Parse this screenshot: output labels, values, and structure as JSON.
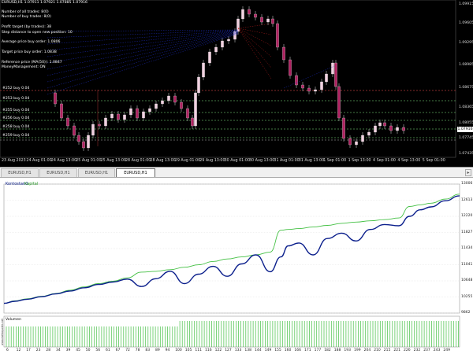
{
  "price_panel": {
    "header": "EURUSD,H1  1.07911 1.07921 1.07885 1.07916",
    "info_lines": [
      "Number of all trades: 8(0)",
      "Number of buy trades: 8(0)",
      "",
      "Profit target (by trades): 38",
      "Step distance to open new position: 10",
      "",
      "Average price buy order: 1.0806",
      "",
      "Target price buy order: 1.0838",
      "",
      "Reference price (MA(50)): 1.0847",
      "MoneyManagement: ON"
    ],
    "levels": [
      "#252 buy 0.04",
      "#253 buy 0.04",
      "#255 buy 0.04",
      "#256 buy 0.04",
      "#258 buy 0.04",
      "#259 buy 0.04"
    ],
    "price_ticks": [
      "1.09915",
      "1.09605",
      "1.09295",
      "1.08985",
      "1.08675",
      "1.08365",
      "1.08055",
      "1.07745",
      "1.07435"
    ],
    "current_price": "1.07916",
    "date_ticks": [
      "23 Aug 2023",
      "24 Aug 01:00",
      "24 Aug 13:00",
      "25 Aug 01:00",
      "25 Aug 13:00",
      "28 Aug 01:00",
      "28 Aug 13:00",
      "29 Aug 01:00",
      "29 Aug 13:00",
      "30 Aug 01:00",
      "30 Aug 13:00",
      "31 Aug 01:00",
      "31 Aug 13:00",
      "1 Sep 01:00",
      "1 Sep 13:00",
      "4 Sep 01:00",
      "4 Sep 13:00",
      "5 Sep 01:00"
    ]
  },
  "tabs": [
    "EURUSD,H1 (visual)",
    "EURUSD,H1 (visual)",
    "EURUSD,H1 (visual)",
    "EURUSD,H1 (visual)"
  ],
  "active_tab": 3,
  "tester": {
    "legend_balance": "Kontostand",
    "legend_equity": "Kapital",
    "volume_label": "Volumen",
    "side_caption": "www.metaquotes.net",
    "colors": {
      "balance": "#0b1f8c",
      "equity": "#44c044",
      "volume": "#44c044"
    },
    "y_ticks": [
      "13006",
      "12613",
      "12220",
      "11827",
      "11434",
      "11041",
      "10648",
      "10255",
      "9862"
    ],
    "x_ticks": [
      "6",
      "12",
      "17",
      "23",
      "28",
      "34",
      "39",
      "45",
      "50",
      "56",
      "61",
      "67",
      "72",
      "78",
      "83",
      "89",
      "94",
      "100",
      "105",
      "111",
      "116",
      "122",
      "127",
      "133",
      "138",
      "144",
      "149",
      "155",
      "160",
      "166",
      "171",
      "177",
      "182",
      "188",
      "193",
      "199",
      "204",
      "210",
      "215",
      "221",
      "226",
      "232",
      "237",
      "243",
      "249"
    ]
  },
  "chart_data": {
    "type": "line",
    "title": "",
    "xlabel": "",
    "ylabel": "",
    "ylim": [
      9862,
      13006
    ],
    "x": [
      1,
      7,
      14,
      22,
      30,
      38,
      46,
      54,
      62,
      70,
      78,
      86,
      94,
      102,
      110,
      118,
      126,
      134,
      142,
      150,
      156,
      160,
      166,
      174,
      182,
      190,
      198,
      206,
      214,
      222,
      228,
      234,
      240,
      248,
      256
    ],
    "series": [
      {
        "name": "Kontostand",
        "values": [
          10100,
          10150,
          10200,
          10260,
          10330,
          10400,
          10480,
          10560,
          10620,
          10690,
          10510,
          10700,
          10880,
          10580,
          10810,
          11000,
          10760,
          11060,
          11280,
          10870,
          11230,
          11500,
          11570,
          11280,
          11680,
          11810,
          11620,
          11900,
          12020,
          11990,
          12220,
          12380,
          12450,
          12600,
          12720
        ]
      },
      {
        "name": "Kapital",
        "values": [
          10100,
          10160,
          10210,
          10270,
          10340,
          10420,
          10500,
          10580,
          10640,
          10720,
          10860,
          10880,
          10920,
          10980,
          11040,
          11120,
          11180,
          11230,
          11280,
          11350,
          11880,
          11900,
          11920,
          11960,
          12000,
          12050,
          12080,
          12110,
          12140,
          12180,
          12460,
          12500,
          12540,
          12640,
          12760
        ]
      }
    ]
  }
}
